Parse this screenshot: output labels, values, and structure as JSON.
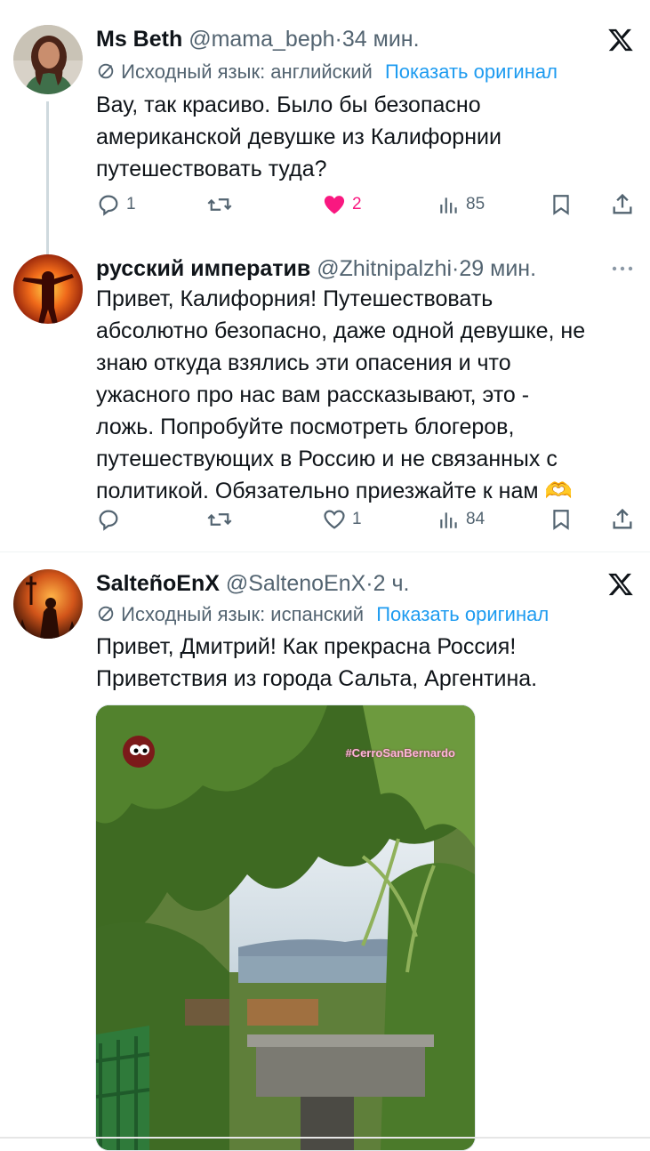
{
  "tweets": [
    {
      "name": "Ms Beth",
      "handle": "@mama_beph",
      "dot": "·",
      "time": "34 мин.",
      "translation_note": "Исходный язык: английский",
      "show_original": "Показать оригинал",
      "text": [
        "Вау, так красиво. Было бы безопасно",
        "американской девушке из Калифорнии",
        "путешествовать туда?"
      ],
      "replies": "1",
      "retweets": "",
      "likes": "2",
      "liked": true,
      "views": "85",
      "corner_icon": "x-logo-icon"
    },
    {
      "name": "русский императив",
      "handle": "@Zhitnipalzhi",
      "dot": "·",
      "time": "29 мин.",
      "text": [
        "Привет, Калифорния! Путешествовать",
        "абсолютно безопасно, даже одной девушке, не",
        "знаю откуда взялись эти опасения и что",
        "ужасного про нас вам рассказывают, это -",
        "ложь. Попробуйте посмотреть блогеров,",
        "путешествующих в Россию и не связанных с",
        "политикой. Обязательно приезжайте к нам"
      ],
      "emoji": "🫶",
      "replies": "",
      "retweets": "",
      "likes": "1",
      "liked": false,
      "views": "84",
      "corner_icon": "more-icon"
    },
    {
      "name": "SalteñoEnX",
      "handle": "@SaltenoEnX",
      "dot": "·",
      "time": "2 ч.",
      "translation_note": "Исходный язык: испанский",
      "show_original": "Показать оригинал",
      "text": [
        "Привет, Дмитрий! Как прекрасна Россия!",
        "Приветствия из города Сальта, Аргентина."
      ],
      "media_tag": "#CerroSanBernardo",
      "corner_icon": "x-logo-icon"
    }
  ],
  "colors": {
    "text": "#0f1419",
    "secondary": "#536471",
    "link": "#1d9bf0",
    "like": "#f91880",
    "divider": "#eff3f4"
  }
}
